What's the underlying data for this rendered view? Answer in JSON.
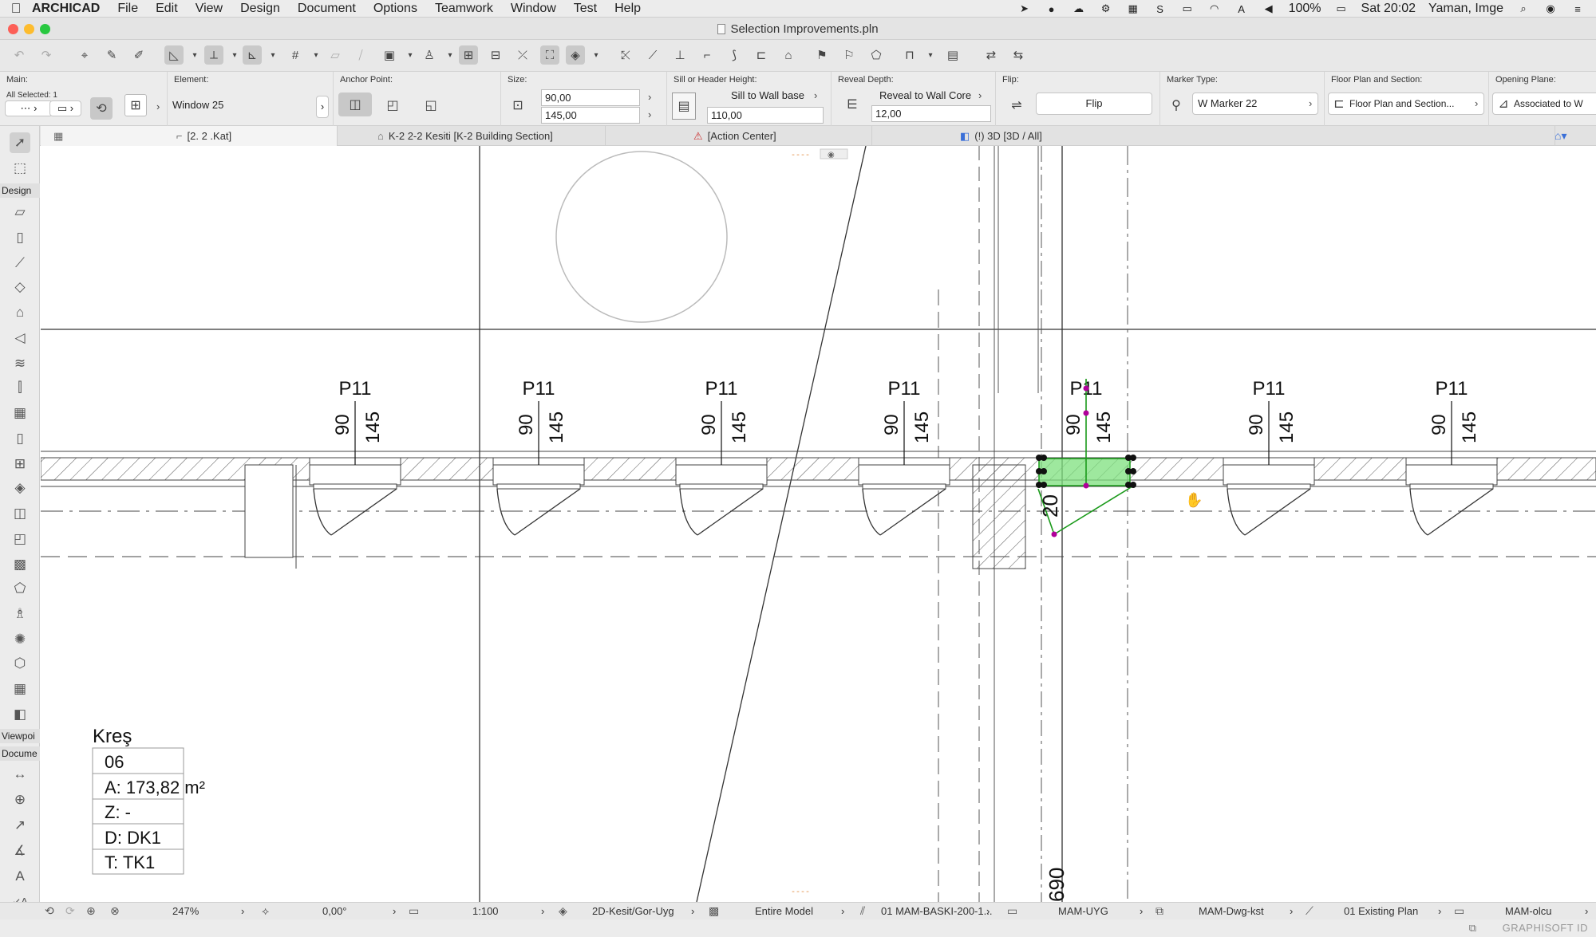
{
  "menubar": {
    "app": "ARCHICAD",
    "items": [
      "File",
      "Edit",
      "View",
      "Design",
      "Document",
      "Options",
      "Teamwork",
      "Window",
      "Test",
      "Help"
    ],
    "battery": "100%",
    "clock": "Sat 20:02",
    "user": "Yaman, Imge"
  },
  "window": {
    "title": "Selection Improvements.pln"
  },
  "infobox": {
    "main_label": "Main:",
    "selection_count": "All Selected: 1",
    "element_label": "Element:",
    "element_value": "Window 25",
    "anchor_label": "Anchor Point:",
    "size_label": "Size:",
    "width": "90,00",
    "height": "145,00",
    "sill_label": "Sill or Header Height:",
    "sill_mode": "Sill to Wall base",
    "sill_value": "110,00",
    "reveal_label": "Reveal Depth:",
    "reveal_mode": "Reveal to Wall Core",
    "reveal_value": "12,00",
    "flip_label": "Flip:",
    "flip_button": "Flip",
    "marker_label": "Marker Type:",
    "marker_value": "W Marker 22",
    "floorplan_label": "Floor Plan and Section:",
    "floorplan_value": "Floor Plan and Section...",
    "opening_label": "Opening Plane:",
    "opening_value": "Associated to W"
  },
  "tabs": [
    {
      "label": "[2. 2 .Kat]"
    },
    {
      "label": "K-2 2-2 Kesiti [K-2 Building Section]"
    },
    {
      "label": "[Action Center]"
    },
    {
      "label": "(!) 3D [3D / All]"
    }
  ],
  "toolbox": {
    "design_header": "Design",
    "viewpoint_header": "Viewpoi",
    "document_header": "Docume"
  },
  "drawing": {
    "window_tags": [
      {
        "name": "P11",
        "width": "90",
        "height": "145"
      },
      {
        "name": "P11",
        "width": "90",
        "height": "145"
      },
      {
        "name": "P11",
        "width": "90",
        "height": "145"
      },
      {
        "name": "P11",
        "width": "90",
        "height": "145"
      },
      {
        "name": "P11",
        "width": "90",
        "height": "145"
      },
      {
        "name": "P11",
        "width": "90",
        "height": "145"
      },
      {
        "name": "P11",
        "width": "90",
        "height": "145"
      }
    ],
    "selected_dim": "20",
    "bottom_dim": "690",
    "zone": {
      "name": "Kreş",
      "number": "06",
      "area": "A: 173,82 m²",
      "z": "Z: -",
      "d": "D: DK1",
      "t": "T: TK1"
    },
    "selection_color": "#7ee07e",
    "selection_stroke": "#1a9a1a",
    "hotspot_color": "#b0009a"
  },
  "statusbar": {
    "zoom": "247%",
    "angle": "0,00°",
    "scale": "1:100",
    "layer_combo": "2D-Kesit/Gor-Uyg",
    "model": "Entire Model",
    "pen_set": "01 MAM-BASKI-200-1...",
    "mvo": "MAM-UYG",
    "dwg": "MAM-Dwg-kst",
    "renovation": "01 Existing Plan",
    "dimension": "MAM-olcu"
  },
  "footer": {
    "brand": "GRAPHISOFT ID"
  }
}
